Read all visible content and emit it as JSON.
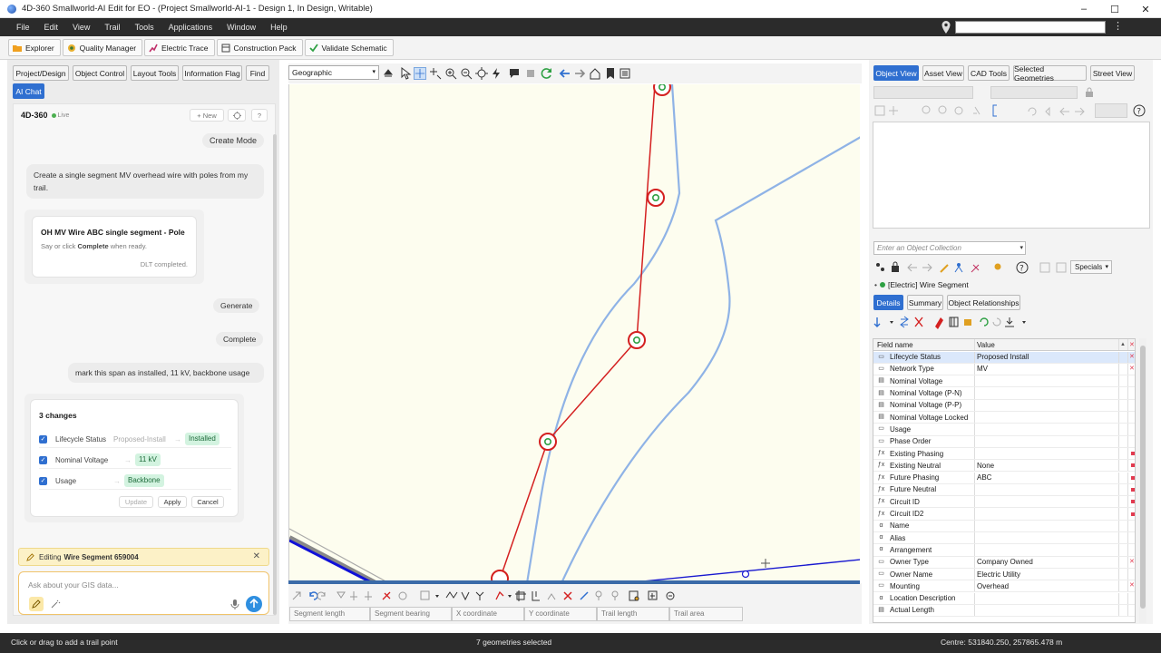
{
  "window": {
    "title": "4D-360 Smallworld-AI Edit for EO - (Project Smallworld-AI-1 - Design 1, In Design, Writable)",
    "controls": [
      "–",
      "☐",
      "✕"
    ]
  },
  "menu": [
    "File",
    "Edit",
    "View",
    "Trail",
    "Tools",
    "Applications",
    "Window",
    "Help"
  ],
  "toolbar": [
    "Explorer",
    "Quality Manager",
    "Electric Trace",
    "Construction Pack",
    "Validate Schematic"
  ],
  "left_tabs": [
    "Project/Design",
    "Object Control",
    "Layout Tools",
    "Information Flag",
    "Find",
    "AI Chat"
  ],
  "chat": {
    "brand": "4D-360",
    "live": "Live",
    "new_btn": "+ New",
    "help_btn": "?",
    "msg_create_mode": "Create Mode",
    "msg_user_1": "Create a single segment MV overhead wire with poles from my trail.",
    "card1": {
      "title": "OH MV Wire ABC single segment - Pole",
      "hint_pre": "Say or click ",
      "hint_bold": "Complete",
      "hint_post": " when ready.",
      "status": "DLT completed."
    },
    "msg_generate": "Generate",
    "msg_complete": "Complete",
    "msg_user_2": "mark this span as installed, 11 kV, backbone usage",
    "changes": {
      "title": "3 changes",
      "rows": [
        {
          "field": "Lifecycle Status",
          "old": "Proposed-Install",
          "arrow": "→",
          "new": "Installed"
        },
        {
          "field": "Nominal Voltage",
          "old": "",
          "arrow": "→",
          "new": "11 kV"
        },
        {
          "field": "Usage",
          "old": "",
          "arrow": "→",
          "new": "Backbone"
        }
      ],
      "buttons": [
        "Update",
        "Apply",
        "Cancel"
      ]
    },
    "editing_label": "Editing",
    "editing_object": "Wire Segment 659004",
    "input_placeholder": "Ask about your GIS data..."
  },
  "map": {
    "view_select": "Geographic",
    "coord_fields": [
      "Segment length",
      "Segment bearing",
      "X coordinate",
      "Y coordinate",
      "Trail length",
      "Trail area"
    ]
  },
  "right_tabs": [
    "Object View",
    "Asset View",
    "CAD Tools",
    "Selected Geometries",
    "Street View"
  ],
  "collection_placeholder": "Enter an Object Collection",
  "specials": "Specials",
  "object_title": "[Electric] Wire Segment",
  "detail_tabs": [
    "Details",
    "Summary",
    "Object Relationships"
  ],
  "grid_headers": [
    "Field name",
    "Value"
  ],
  "grid_rows": [
    {
      "icon": "▭",
      "name": "Lifecycle Status",
      "value": "Proposed Install",
      "mark": "x"
    },
    {
      "icon": "▭",
      "name": "Network Type",
      "value": "MV",
      "mark": "x"
    },
    {
      "icon": "▤",
      "name": "Nominal Voltage",
      "value": "",
      "mark": ""
    },
    {
      "icon": "▤",
      "name": "Nominal Voltage (P-N)",
      "value": "",
      "mark": ""
    },
    {
      "icon": "▤",
      "name": "Nominal Voltage (P-P)",
      "value": "",
      "mark": ""
    },
    {
      "icon": "▤",
      "name": "Nominal Voltage Locked",
      "value": "",
      "mark": ""
    },
    {
      "icon": "▭",
      "name": "Usage",
      "value": "",
      "mark": ""
    },
    {
      "icon": "▭",
      "name": "Phase Order",
      "value": "",
      "mark": ""
    },
    {
      "icon": "ƒx",
      "name": "Existing Phasing",
      "value": "",
      "mark": "sq"
    },
    {
      "icon": "ƒx",
      "name": "Existing Neutral",
      "value": "None",
      "mark": "sq"
    },
    {
      "icon": "ƒx",
      "name": "Future Phasing",
      "value": "ABC",
      "mark": "sq"
    },
    {
      "icon": "ƒx",
      "name": "Future Neutral",
      "value": "",
      "mark": "sq"
    },
    {
      "icon": "ƒx",
      "name": "Circuit ID",
      "value": "",
      "mark": "sq"
    },
    {
      "icon": "ƒx",
      "name": "Circuit ID2",
      "value": "",
      "mark": "sq"
    },
    {
      "icon": "α",
      "name": "Name",
      "value": "",
      "mark": ""
    },
    {
      "icon": "α",
      "name": "Alias",
      "value": "",
      "mark": ""
    },
    {
      "icon": "α",
      "name": "Arrangement",
      "value": "",
      "mark": ""
    },
    {
      "icon": "▭",
      "name": "Owner Type",
      "value": "Company Owned",
      "mark": "x"
    },
    {
      "icon": "▭",
      "name": "Owner Name",
      "value": "Electric Utility",
      "mark": ""
    },
    {
      "icon": "▭",
      "name": "Mounting",
      "value": "Overhead",
      "mark": "x"
    },
    {
      "icon": "α",
      "name": "Location Description",
      "value": "",
      "mark": ""
    },
    {
      "icon": "▤",
      "name": "Actual Length",
      "value": "",
      "mark": ""
    }
  ],
  "status": {
    "left": "Click or drag to add a trail point",
    "center": "7 geometries selected",
    "right": "Centre: 531840.250, 257865.478 m"
  }
}
